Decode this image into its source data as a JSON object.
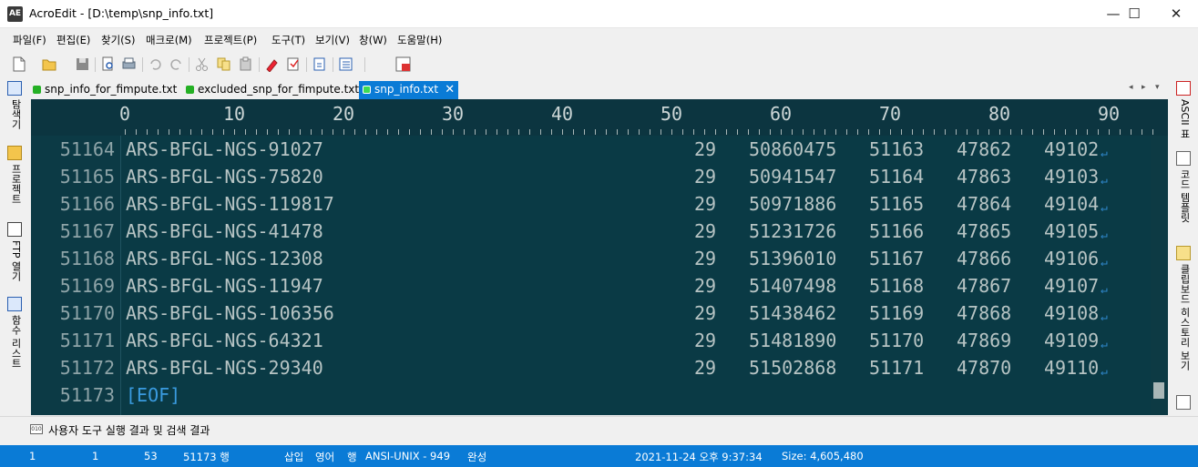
{
  "window": {
    "app_icon": "AE",
    "title": "AcroEdit - [D:\\temp\\snp_info.txt]",
    "minimize": "—",
    "maximize": "☐",
    "close": "✕"
  },
  "menu": [
    {
      "label": "파일(F)"
    },
    {
      "label": "편집(E)"
    },
    {
      "label": "찾기(S)"
    },
    {
      "label": "매크로(M)"
    },
    {
      "label": "프로젝트(P)"
    },
    {
      "label": "도구(T)"
    },
    {
      "label": "보기(V)"
    },
    {
      "label": "창(W)"
    },
    {
      "label": "도움말(H)"
    }
  ],
  "toolbar_icons": [
    "new-file-icon",
    "open-folder-icon",
    "save-icon",
    "print-preview-icon",
    "print-icon",
    "undo-icon",
    "redo-icon",
    "cut-icon",
    "copy-icon",
    "paste-icon",
    "highlight-icon",
    "bookmark-icon",
    "find-icon",
    "list-icon",
    "window-icon"
  ],
  "tabs": {
    "items": [
      {
        "label": "snp_info_for_fimpute.txt",
        "active": false
      },
      {
        "label": "excluded_snp_for_fimpute.txt",
        "active": false
      },
      {
        "label": "snp_info.txt",
        "active": true
      }
    ],
    "close_glyph": "✕",
    "nav_prev": "◂",
    "nav_next": "▸",
    "nav_list": "▾"
  },
  "left_panel": [
    {
      "label": "탐색기",
      "icon": "explorer-icon"
    },
    {
      "label": "프로젝트",
      "icon": "project-icon"
    },
    {
      "label": "FTP 열기",
      "icon": "ftp-icon"
    },
    {
      "label": "함수 리스트",
      "icon": "function-list-icon"
    }
  ],
  "right_panel": [
    {
      "label": "ASCII 표",
      "icon": "ascii-table-icon"
    },
    {
      "label": "코드 템플릿",
      "icon": "code-template-icon"
    },
    {
      "label": "클립보드 히스토리 보기",
      "icon": "clipboard-history-icon"
    }
  ],
  "ruler": [
    "0",
    "10",
    "20",
    "30",
    "40",
    "50",
    "60",
    "70",
    "80",
    "90"
  ],
  "lines": [
    {
      "ln": "51164",
      "name": "ARS-BFGL-NGS-91027",
      "chr": "29",
      "pos": "50860475",
      "c1": "51163",
      "c2": "47862",
      "c3": "49102"
    },
    {
      "ln": "51165",
      "name": "ARS-BFGL-NGS-75820",
      "chr": "29",
      "pos": "50941547",
      "c1": "51164",
      "c2": "47863",
      "c3": "49103"
    },
    {
      "ln": "51166",
      "name": "ARS-BFGL-NGS-119817",
      "chr": "29",
      "pos": "50971886",
      "c1": "51165",
      "c2": "47864",
      "c3": "49104"
    },
    {
      "ln": "51167",
      "name": "ARS-BFGL-NGS-41478",
      "chr": "29",
      "pos": "51231726",
      "c1": "51166",
      "c2": "47865",
      "c3": "49105"
    },
    {
      "ln": "51168",
      "name": "ARS-BFGL-NGS-12308",
      "chr": "29",
      "pos": "51396010",
      "c1": "51167",
      "c2": "47866",
      "c3": "49106"
    },
    {
      "ln": "51169",
      "name": "ARS-BFGL-NGS-11947",
      "chr": "29",
      "pos": "51407498",
      "c1": "51168",
      "c2": "47867",
      "c3": "49107"
    },
    {
      "ln": "51170",
      "name": "ARS-BFGL-NGS-106356",
      "chr": "29",
      "pos": "51438462",
      "c1": "51169",
      "c2": "47868",
      "c3": "49108"
    },
    {
      "ln": "51171",
      "name": "ARS-BFGL-NGS-64321",
      "chr": "29",
      "pos": "51481890",
      "c1": "51170",
      "c2": "47869",
      "c3": "49109"
    },
    {
      "ln": "51172",
      "name": "ARS-BFGL-NGS-29340",
      "chr": "29",
      "pos": "51502868",
      "c1": "51171",
      "c2": "47870",
      "c3": "49110"
    }
  ],
  "eof_line": {
    "ln": "51173",
    "text": "[EOF]"
  },
  "eol_glyph": "↵",
  "output": {
    "label": "사용자 도구 실행 결과 및 검색 결과",
    "icon_text": "010"
  },
  "status": {
    "col": "1",
    "col2": "1",
    "chars": "53",
    "line": "51173 행",
    "insert": "삽입",
    "lang": "영어",
    "mode": "행",
    "encoding": "ANSI-UNIX - 949",
    "state": "완성",
    "datetime": "2021-11-24 오후 9:37:34",
    "size": "Size: 4,605,480"
  },
  "colors": {
    "editor_bg": "#0a3a45",
    "accent": "#0a7bd6",
    "eof": "#3a9be0"
  }
}
